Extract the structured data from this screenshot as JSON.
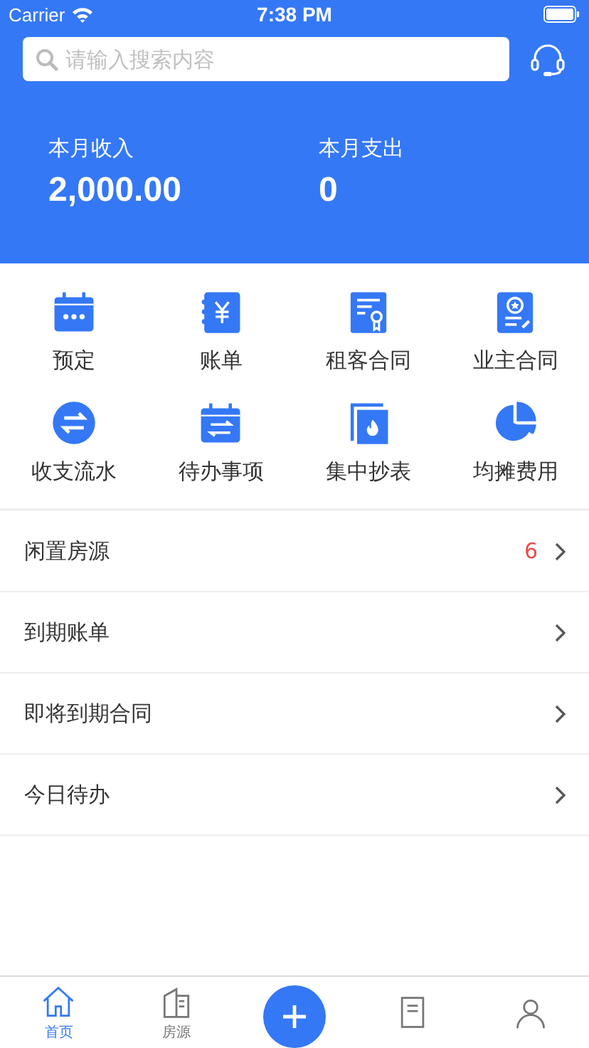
{
  "status_bar": {
    "carrier": "Carrier",
    "time": "7:38 PM"
  },
  "search": {
    "placeholder": "请输入搜索内容"
  },
  "summary": [
    {
      "label": "本月收入",
      "value": "2,000.00"
    },
    {
      "label": "本月支出",
      "value": "0"
    }
  ],
  "shortcuts": [
    {
      "kind": "calendar",
      "label": "预定"
    },
    {
      "kind": "bill",
      "label": "账单"
    },
    {
      "kind": "certificate",
      "label": "租客合同"
    },
    {
      "kind": "badge",
      "label": "业主合同"
    },
    {
      "kind": "exchange",
      "label": "收支流水"
    },
    {
      "kind": "todo",
      "label": "待办事项"
    },
    {
      "kind": "meter",
      "label": "集中抄表"
    },
    {
      "kind": "pie",
      "label": "均摊费用"
    }
  ],
  "list": [
    {
      "label": "闲置房源",
      "count": "6"
    },
    {
      "label": "到期账单"
    },
    {
      "label": "即将到期合同"
    },
    {
      "label": "今日待办"
    }
  ],
  "tab_bar": [
    {
      "kind": "home",
      "label": "首页",
      "selected": true
    },
    {
      "kind": "building",
      "label": "房源",
      "selected": false
    },
    {
      "kind": "add"
    },
    {
      "kind": "document",
      "selected": false
    },
    {
      "kind": "person",
      "selected": false
    }
  ]
}
